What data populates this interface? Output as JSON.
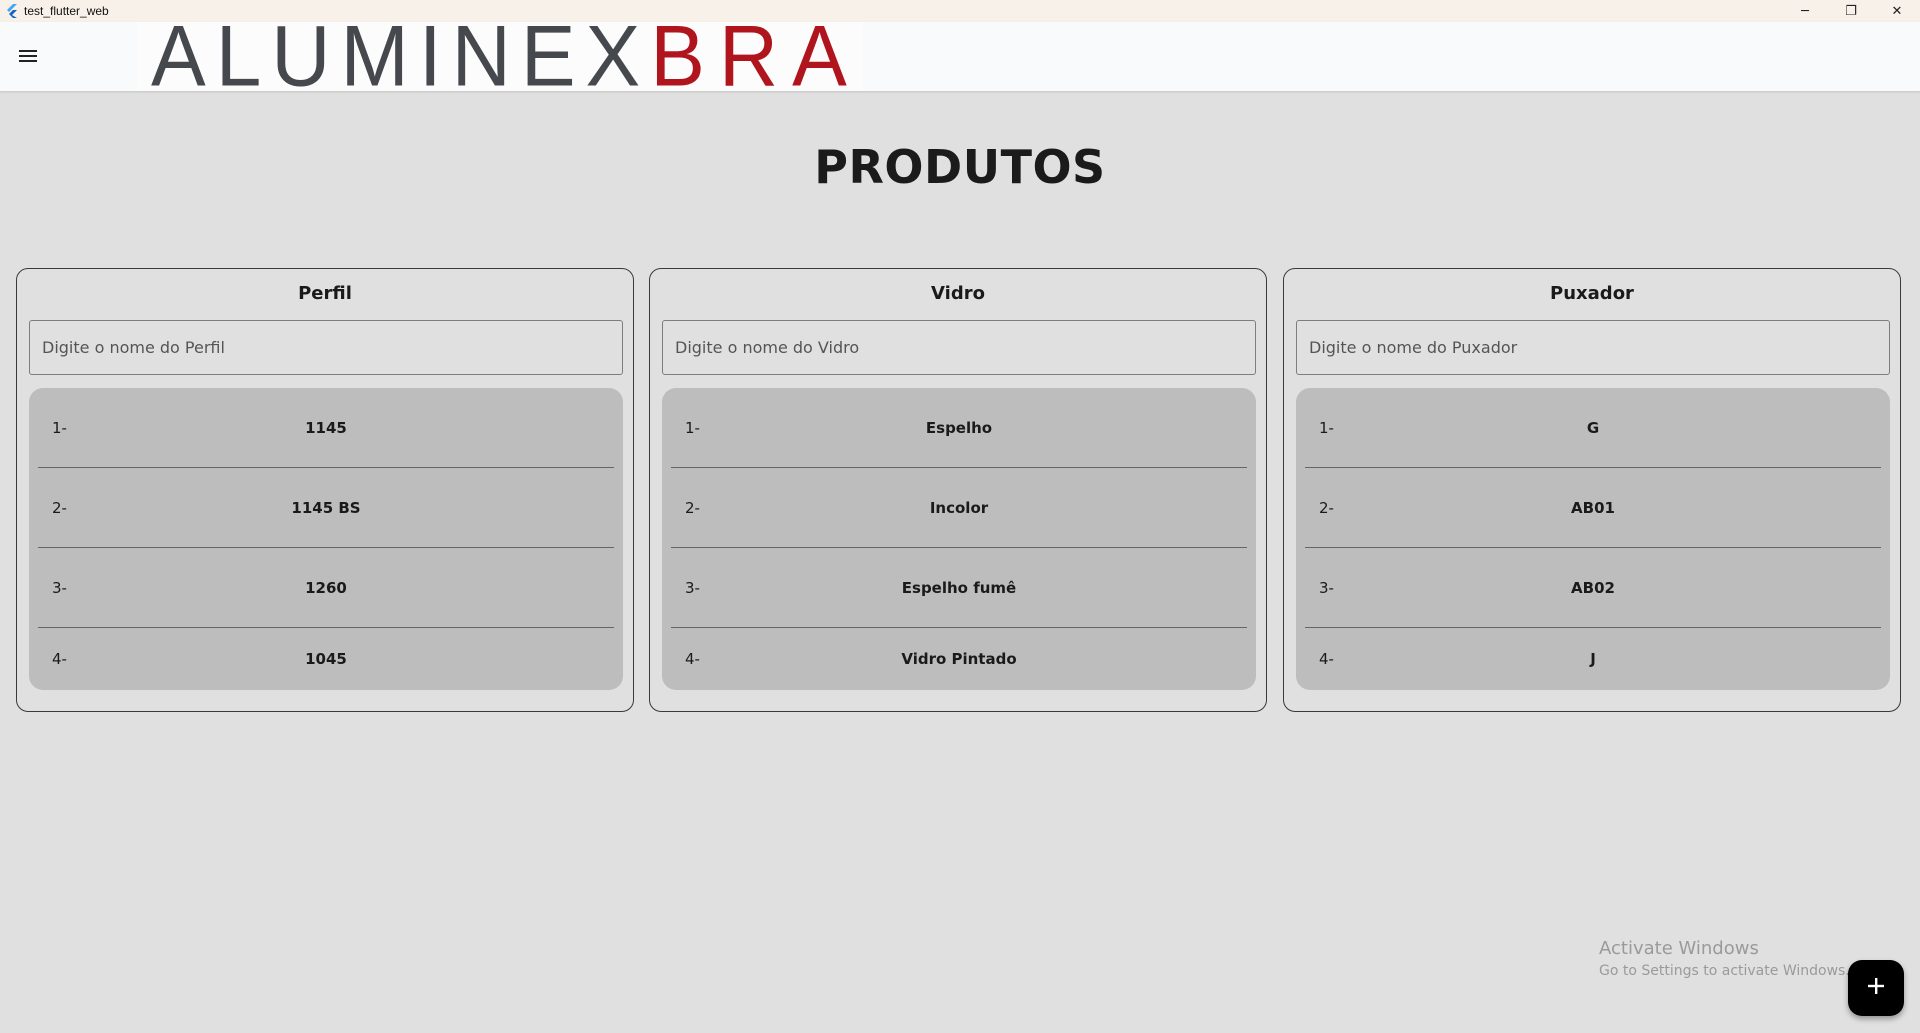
{
  "window": {
    "title": "test_flutter_web",
    "controls": {
      "minimize": "─",
      "restore": "❐",
      "close": "✕"
    }
  },
  "appbar": {
    "menu_icon": "hamburger-menu-icon",
    "logo": {
      "part1": "ALUMINEX",
      "part2": "BRASIL"
    }
  },
  "page": {
    "title": "PRODUTOS"
  },
  "cards": [
    {
      "title": "Perfil",
      "search_placeholder": "Digite o nome do Perfil",
      "items": [
        {
          "index": "1-",
          "name": "1145"
        },
        {
          "index": "2-",
          "name": "1145 BS"
        },
        {
          "index": "3-",
          "name": "1260"
        },
        {
          "index": "4-",
          "name": "1045"
        }
      ]
    },
    {
      "title": "Vidro",
      "search_placeholder": "Digite o nome do Vidro",
      "items": [
        {
          "index": "1-",
          "name": "Espelho"
        },
        {
          "index": "2-",
          "name": "Incolor"
        },
        {
          "index": "3-",
          "name": "Espelho fumê"
        },
        {
          "index": "4-",
          "name": "Vidro Pintado"
        }
      ]
    },
    {
      "title": "Puxador",
      "search_placeholder": "Digite o nome do Puxador",
      "items": [
        {
          "index": "1-",
          "name": "G"
        },
        {
          "index": "2-",
          "name": "AB01"
        },
        {
          "index": "3-",
          "name": "AB02"
        },
        {
          "index": "4-",
          "name": "J"
        }
      ]
    }
  ],
  "watermark": {
    "line1": "Activate Windows",
    "line2": "Go to Settings to activate Windows."
  },
  "fab": {
    "icon": "plus-icon"
  },
  "colors": {
    "background": "#e0e0e0",
    "appbar": "#f8fafb",
    "list_bg": "#bdbdbd",
    "logo_gray": "#45484d",
    "logo_red": "#b0141c",
    "fab": "#000000"
  }
}
